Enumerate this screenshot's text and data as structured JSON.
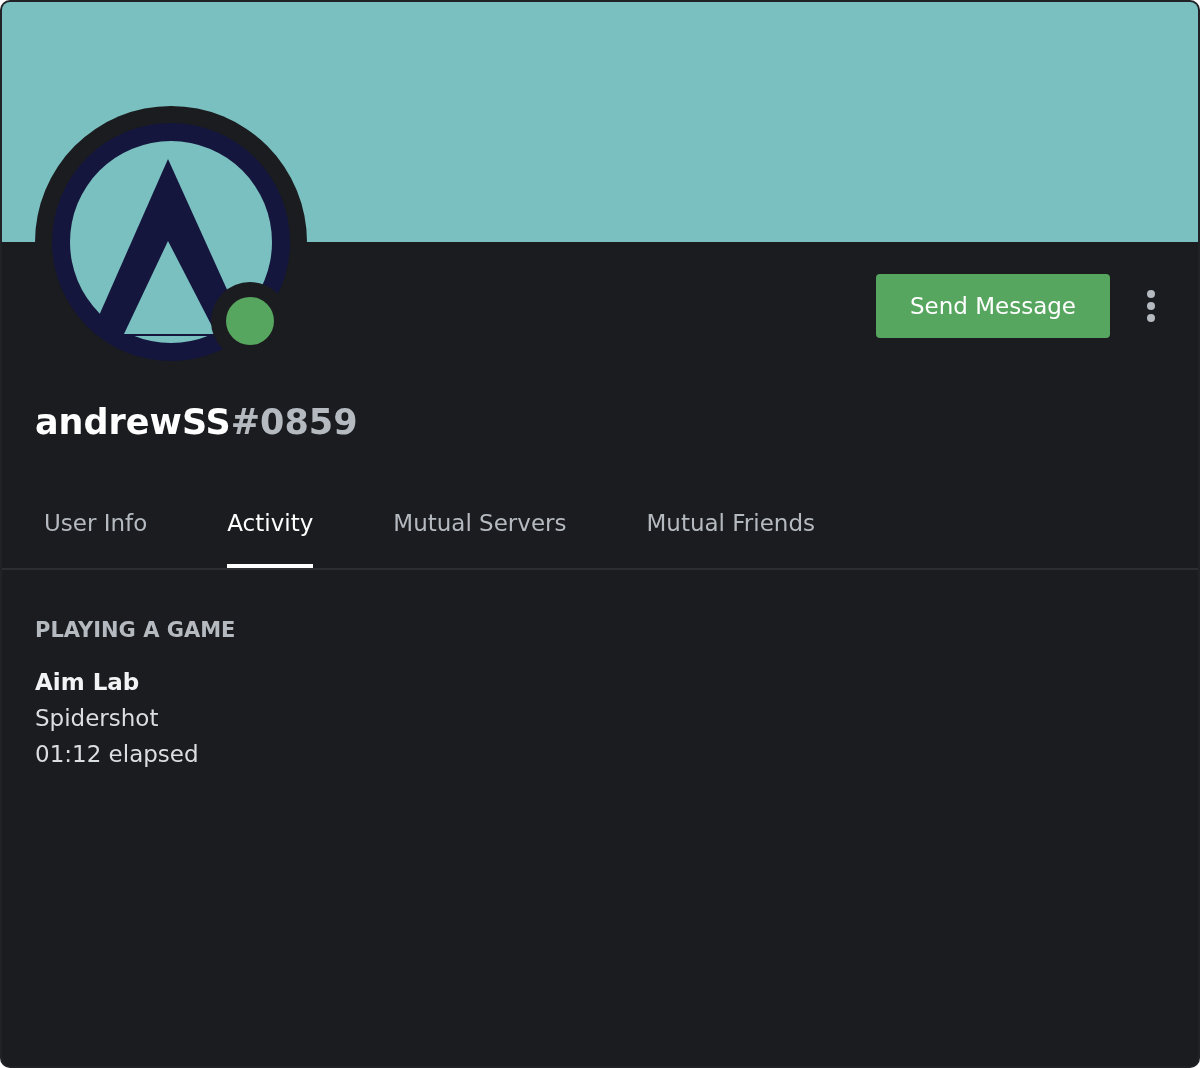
{
  "profile": {
    "username": "andrewSS",
    "discriminator": "#0859",
    "online": true
  },
  "actions": {
    "primary_button": "Send Message"
  },
  "tabs": [
    {
      "label": "User Info",
      "selected": false
    },
    {
      "label": "Activity",
      "selected": true
    },
    {
      "label": "Mutual Servers",
      "selected": false
    },
    {
      "label": "Mutual Friends",
      "selected": false
    }
  ],
  "activity": {
    "heading": "PLAYING A GAME",
    "game": "Aim Lab",
    "details": "Spidershot",
    "elapsed": "01:12 elapsed"
  }
}
